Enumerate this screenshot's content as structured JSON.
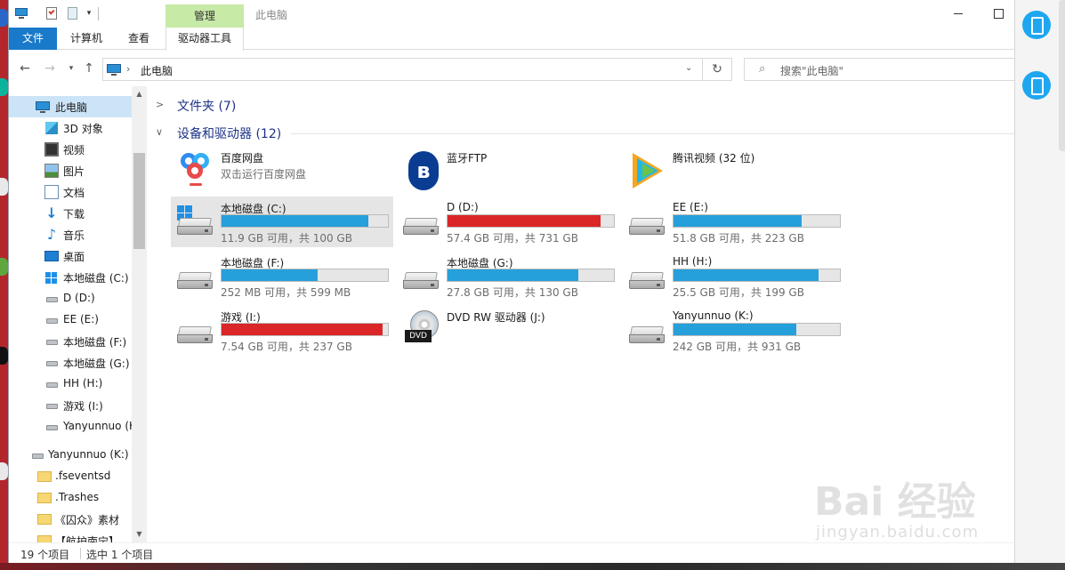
{
  "window": {
    "title": "此电脑",
    "manage_tab": "管理"
  },
  "ribbon": {
    "tabs": [
      "文件",
      "计算机",
      "查看",
      "驱动器工具"
    ]
  },
  "address": {
    "path": "此电脑",
    "search_placeholder": "搜索\"此电脑\""
  },
  "nav": {
    "items": [
      {
        "label": "此电脑",
        "icon": "pc-icon"
      },
      {
        "label": "3D 对象",
        "icon": "3d-objects-icon"
      },
      {
        "label": "视频",
        "icon": "video-icon"
      },
      {
        "label": "图片",
        "icon": "pictures-icon"
      },
      {
        "label": "文档",
        "icon": "documents-icon"
      },
      {
        "label": "下载",
        "icon": "download-icon"
      },
      {
        "label": "音乐",
        "icon": "music-icon"
      },
      {
        "label": "桌面",
        "icon": "desktop-icon"
      },
      {
        "label": "本地磁盘 (C:)",
        "icon": "windows-drive-icon"
      },
      {
        "label": "D (D:)",
        "icon": "drive-icon"
      },
      {
        "label": "EE (E:)",
        "icon": "drive-icon"
      },
      {
        "label": "本地磁盘 (F:)",
        "icon": "drive-icon"
      },
      {
        "label": "本地磁盘 (G:)",
        "icon": "drive-icon"
      },
      {
        "label": "HH (H:)",
        "icon": "drive-icon"
      },
      {
        "label": "游戏 (I:)",
        "icon": "drive-icon"
      },
      {
        "label": "Yanyunnuo (K:)",
        "icon": "drive-icon"
      },
      {
        "label": "Yanyunnuo (K:)",
        "icon": "drive-icon"
      },
      {
        "label": ".fseventsd",
        "icon": "folder-icon"
      },
      {
        "label": ".Trashes",
        "icon": "folder-icon"
      },
      {
        "label": "《囚众》素材",
        "icon": "folder-icon"
      },
      {
        "label": "【航护南宁】",
        "icon": "folder-icon"
      }
    ]
  },
  "content": {
    "folders_header": "文件夹 (7)",
    "devices_header": "设备和驱动器 (12)",
    "apps": [
      {
        "name": "百度网盘",
        "sub": "双击运行百度网盘",
        "icon": "baidu-netdisk-icon"
      },
      {
        "name": "蓝牙FTP",
        "sub": "",
        "icon": "bluetooth-icon"
      },
      {
        "name": "腾讯视频 (32 位)",
        "sub": "",
        "icon": "tencent-video-icon"
      }
    ],
    "drives": [
      {
        "name": "本地磁盘 (C:)",
        "free": "11.9 GB 可用，共 100 GB",
        "used_fraction": 0.881,
        "bar_color": "#26a0da"
      },
      {
        "name": "D (D:)",
        "free": "57.4 GB 可用，共 731 GB",
        "used_fraction": 0.921,
        "bar_color": "#da2626"
      },
      {
        "name": "EE (E:)",
        "free": "51.8 GB 可用，共 223 GB",
        "used_fraction": 0.768,
        "bar_color": "#26a0da"
      },
      {
        "name": "本地磁盘 (F:)",
        "free": "252 MB 可用，共 599 MB",
        "used_fraction": 0.579,
        "bar_color": "#26a0da"
      },
      {
        "name": "本地磁盘 (G:)",
        "free": "27.8 GB 可用，共 130 GB",
        "used_fraction": 0.786,
        "bar_color": "#26a0da"
      },
      {
        "name": "HH (H:)",
        "free": "25.5 GB 可用，共 199 GB",
        "used_fraction": 0.872,
        "bar_color": "#26a0da"
      },
      {
        "name": "游戏 (I:)",
        "free": "7.54 GB 可用，共 237 GB",
        "used_fraction": 0.968,
        "bar_color": "#da2626"
      },
      {
        "name": "DVD RW 驱动器 (J:)",
        "free": "",
        "used_fraction": null,
        "bar_color": ""
      },
      {
        "name": "Yanyunnuo (K:)",
        "free": "242 GB 可用，共 931 GB",
        "used_fraction": 0.74,
        "bar_color": "#26a0da"
      }
    ],
    "dvd_label": "DVD"
  },
  "status": {
    "count": "19 个项目",
    "selected": "选中 1 个项目"
  },
  "watermark": {
    "logo": "Bai 经验",
    "url": "jingyan.baidu.com"
  }
}
